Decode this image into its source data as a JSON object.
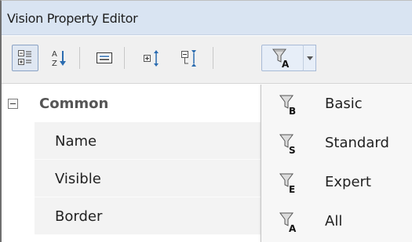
{
  "window": {
    "title": "Vision Property Editor"
  },
  "toolbar": {
    "buttons": [
      {
        "id": "categorized",
        "icon": "categorized-view-icon",
        "pressed": true
      },
      {
        "id": "alphabetical",
        "icon": "sort-alphabetical-icon",
        "pressed": false
      },
      {
        "id": "description",
        "icon": "description-panel-icon",
        "pressed": false
      },
      {
        "id": "expand-all",
        "icon": "expand-all-icon",
        "pressed": false
      },
      {
        "id": "collapse-all",
        "icon": "collapse-all-icon",
        "pressed": false
      },
      {
        "id": "filter",
        "icon": "filter-all-icon",
        "pressed": false,
        "badge": "A"
      }
    ]
  },
  "tree": {
    "group_label": "Common",
    "properties": [
      "Name",
      "Visible",
      "Border"
    ]
  },
  "filter_menu": {
    "items": [
      {
        "label": "Basic",
        "badge": "B"
      },
      {
        "label": "Standard",
        "badge": "S"
      },
      {
        "label": "Expert",
        "badge": "E"
      },
      {
        "label": "All",
        "badge": "A"
      }
    ]
  },
  "colors": {
    "title_bar": "#d9e4f2",
    "toolbar": "#f0f0f0",
    "property_cell": "#f3f3f3",
    "menu": "#f7f7f7",
    "icon_blue": "#2b6cb0"
  }
}
